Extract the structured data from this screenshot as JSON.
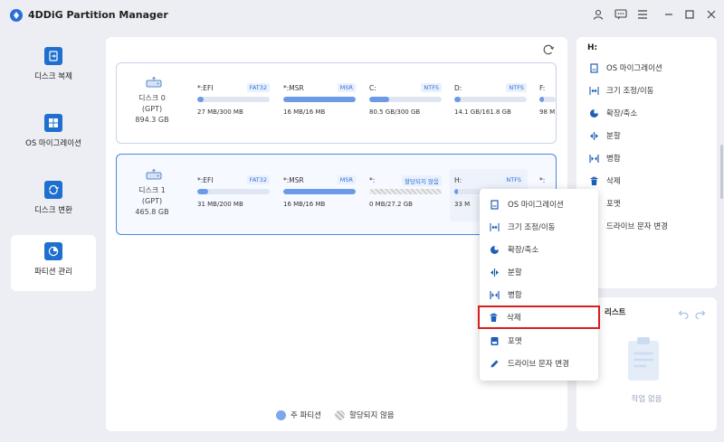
{
  "app": {
    "title": "4DDiG Partition Manager"
  },
  "sidebar": {
    "items": [
      {
        "label": "디스크 복제",
        "icon": "disk-clone-icon"
      },
      {
        "label": "OS 마이그레이션",
        "icon": "os-migration-icon"
      },
      {
        "label": "디스크 변환",
        "icon": "disk-convert-icon"
      },
      {
        "label": "파티션 관리",
        "icon": "partition-manage-icon",
        "active": true
      }
    ]
  },
  "disks": [
    {
      "name": "디스크 0",
      "type": "(GPT)",
      "size": "894.3 GB",
      "partitions": [
        {
          "name": "*:EFI",
          "fs": "FAT32",
          "usage": "27 MB/300 MB",
          "fill": 0.09
        },
        {
          "name": "*:MSR",
          "fs": "MSR",
          "usage": "16 MB/16 MB",
          "fill": 1.0
        },
        {
          "name": "C:",
          "fs": "NTFS",
          "usage": "80.5 GB/300 GB",
          "fill": 0.27
        },
        {
          "name": "D:",
          "fs": "NTFS",
          "usage": "14.1 GB/161.8 GB",
          "fill": 0.09
        },
        {
          "name": "F:",
          "fs": "",
          "usage": "98 M",
          "fill": 0.3
        }
      ]
    },
    {
      "name": "디스크 1",
      "type": "(GPT)",
      "size": "465.8 GB",
      "partitions": [
        {
          "name": "*:EFI",
          "fs": "FAT32",
          "usage": "31 MB/200 MB",
          "fill": 0.15
        },
        {
          "name": "*:MSR",
          "fs": "MSR",
          "usage": "16 MB/16 MB",
          "fill": 1.0
        },
        {
          "name": "*:",
          "fs": "할당되지 않음",
          "usage": "0 MB/27.2 GB",
          "fill": 0.0
        },
        {
          "name": "H:",
          "fs": "NTFS",
          "usage": "33 M",
          "fill": 0.05
        },
        {
          "name": "*:",
          "fs": "",
          "usage": "",
          "fill": 0.0
        }
      ]
    }
  ],
  "legend": {
    "primary": "주 파티션",
    "unallocated": "할당되지 않음"
  },
  "right_panel": {
    "drive": "H:",
    "actions": [
      "OS 마이그레이션",
      "크기 조정/이동",
      "확장/축소",
      "분할",
      "병합",
      "삭제",
      "포맷",
      "드라이브 문자 변경"
    ]
  },
  "operations": {
    "title": "리스트",
    "empty": "작업 없음"
  },
  "context_menu": {
    "items": [
      "OS 마이그레이션",
      "크기 조정/이동",
      "확장/축소",
      "분할",
      "병합",
      "삭제",
      "포맷",
      "드라이브 문자 변경"
    ],
    "highlighted": "삭제"
  },
  "colors": {
    "accent": "#1f6fd1",
    "highlight": "#d81e1e",
    "bar": "#6b9be8"
  }
}
